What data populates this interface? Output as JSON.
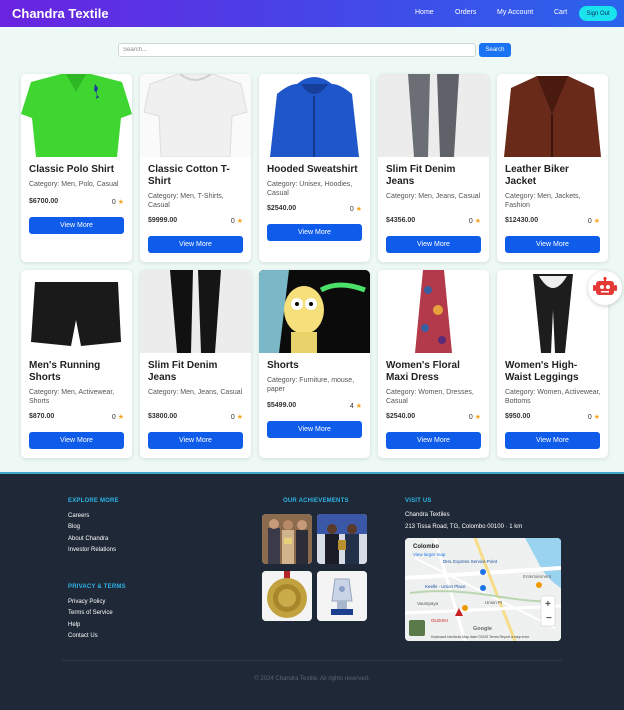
{
  "header": {
    "brand": "Chandra Textile",
    "nav": [
      "Home",
      "Orders",
      "My Account",
      "Cart"
    ],
    "signout_label": "Sign Out"
  },
  "search": {
    "placeholder": "Search...",
    "value": "",
    "button_label": "Search"
  },
  "products": [
    {
      "title": "Classic Polo Shirt",
      "category": "Category: Men, Polo, Casual",
      "price": "$6700.00",
      "rating": "0",
      "button": "View More",
      "image": "green-polo-shirt"
    },
    {
      "title": "Classic Cotton T-Shirt",
      "category": "Category: Men, T-Shirts, Casual",
      "price": "$9999.00",
      "rating": "0",
      "button": "View More",
      "image": "white-t-shirt"
    },
    {
      "title": "Hooded Sweatshirt",
      "category": "Category: Unisex, Hoodies, Casual",
      "price": "$2540.00",
      "rating": "0",
      "button": "View More",
      "image": "blue-hoodie"
    },
    {
      "title": "Slim Fit Denim Jeans",
      "category": "Category: Men, Jeans, Casual",
      "price": "$4356.00",
      "rating": "0",
      "button": "View More",
      "image": "grey-jeans"
    },
    {
      "title": "Leather Biker Jacket",
      "category": "Category: Men, Jackets, Fashion",
      "price": "$12430.00",
      "rating": "0",
      "button": "View More",
      "image": "brown-leather-jacket"
    },
    {
      "title": "Men's Running Shorts",
      "category": "Category: Men, Activewear, Shorts",
      "price": "$870.00",
      "rating": "0",
      "button": "View More",
      "image": "black-shorts"
    },
    {
      "title": "Slim Fit Denim Jeans",
      "category": "Category: Men, Jeans, Casual",
      "price": "$3800.00",
      "rating": "0",
      "button": "View More",
      "image": "black-jeans"
    },
    {
      "title": "Shorts",
      "category": "Category: Furniture, mouse, paper",
      "price": "$5499.00",
      "rating": "4",
      "button": "View More",
      "image": "cartoon-poster"
    },
    {
      "title": "Women's Floral Maxi Dress",
      "category": "Category: Women, Dresses, Casual",
      "price": "$2540.00",
      "rating": "0",
      "button": "View More",
      "image": "floral-dress"
    },
    {
      "title": "Women's High-Waist Leggings",
      "category": "Category: Women, Activewear, Bottoms",
      "price": "$950.00",
      "rating": "0",
      "button": "View More",
      "image": "leggings"
    }
  ],
  "footer": {
    "explore_heading": "EXPLORE MORE",
    "explore_links": [
      "Careers",
      "Blog",
      "About Chandra",
      "Investor Relations"
    ],
    "privacy_heading": "PRIVACY & TERMS",
    "privacy_links": [
      "Privacy Policy",
      "Terms of Service",
      "Help",
      "Contact Us"
    ],
    "achievements_heading": "OUR ACHIEVEMENTS",
    "visit_heading": "VISIT US",
    "company": "Chandra Textiles",
    "address": "213 Tissa Road, TG, Colombo 00100 · 1 km",
    "map": {
      "title": "Colombo",
      "link": "View larger map",
      "labels": [
        "DHL Express Service Point",
        "Keells - Union Place",
        "Vaumpaya",
        "Union Pl",
        "OLDISH",
        "Entertainment"
      ],
      "attribution": "Keyboard shortcuts  Map data ©2025  Terms  Report a map error",
      "google": "Google"
    },
    "copyright": "© 2024 Chandra Textile. All rights reserved."
  },
  "colors": {
    "primary_button": "#0f5bea",
    "header_start": "#6a23e0",
    "header_end": "#2a64ec",
    "signout": "#19e3ec",
    "footer_bg": "#1e2836",
    "footer_heading": "#2fb3e6",
    "star": "#f5a623"
  }
}
